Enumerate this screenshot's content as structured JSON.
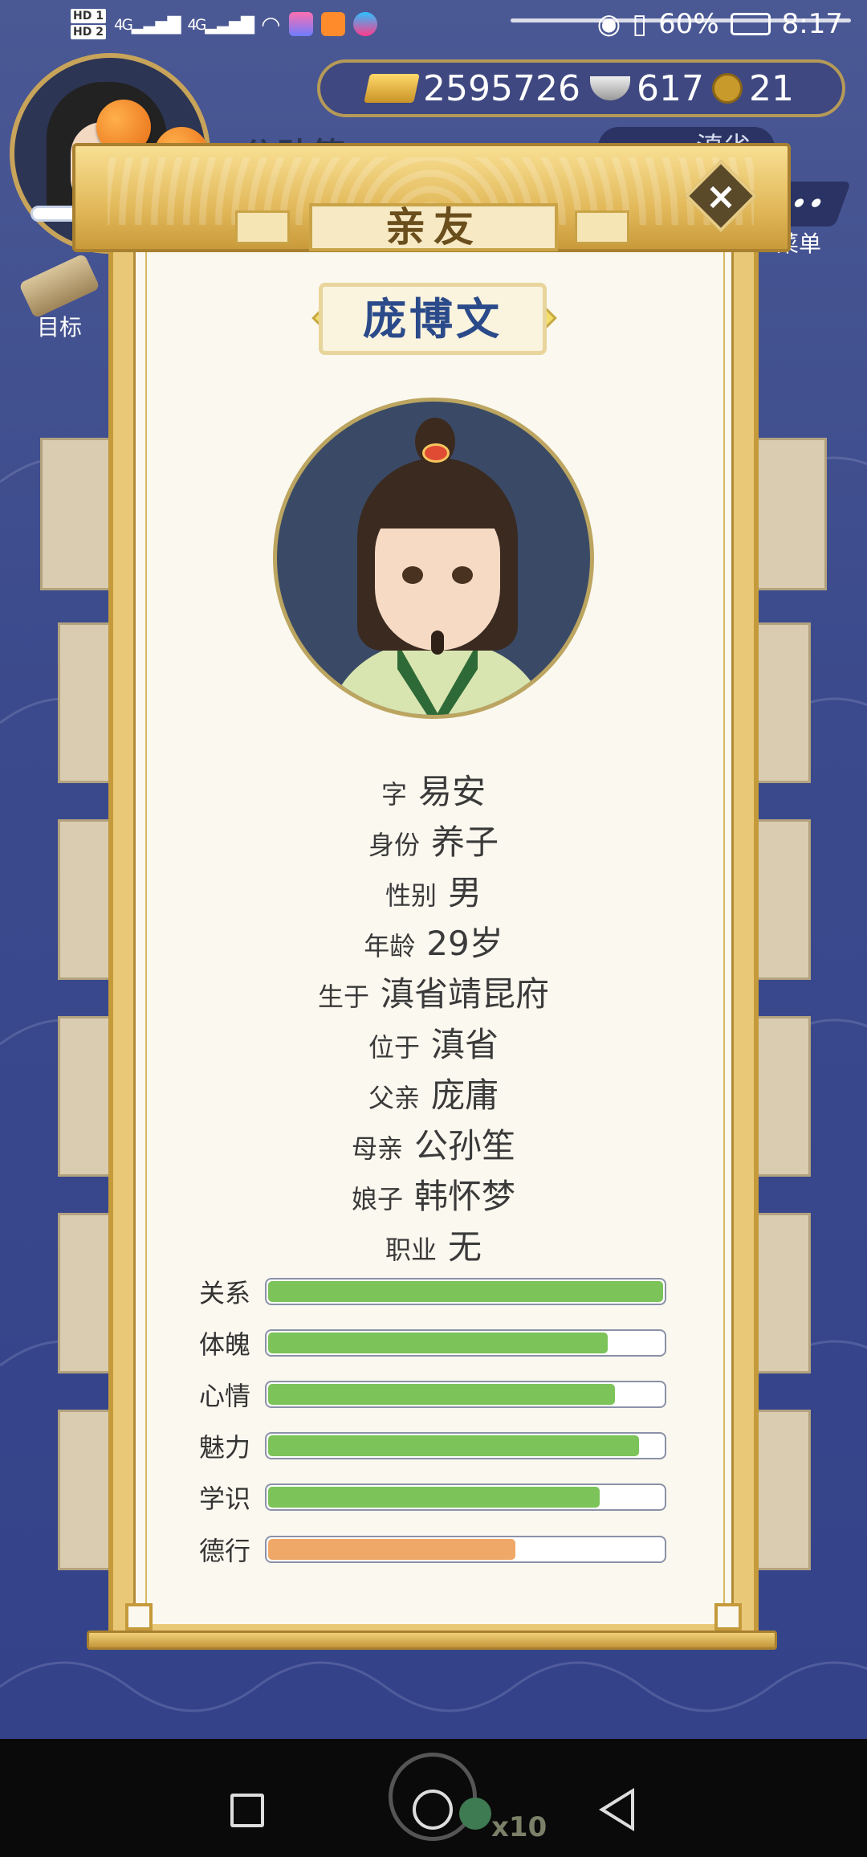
{
  "status_bar": {
    "hd1": "HD 1",
    "hd2": "HD 2",
    "net1": "4G",
    "net2": "4G",
    "battery": "60%",
    "time": "8:17"
  },
  "hud": {
    "character_name": "公孙笙",
    "currency": {
      "gold": "2595726",
      "silver": "617",
      "coin": "21"
    },
    "location_button": "滇省",
    "menu_label": "菜单",
    "goal_label": "目标"
  },
  "dialog": {
    "title": "亲友",
    "close_glyph": "×",
    "person_name": "庞博文",
    "info": [
      {
        "label": "字",
        "value": "易安"
      },
      {
        "label": "身份",
        "value": "养子"
      },
      {
        "label": "性别",
        "value": "男"
      },
      {
        "label": "年龄",
        "value": "29岁"
      },
      {
        "label": "生于",
        "value": "滇省靖昆府"
      },
      {
        "label": "位于",
        "value": "滇省"
      },
      {
        "label": "父亲",
        "value": "庞庸"
      },
      {
        "label": "母亲",
        "value": "公孙笙"
      },
      {
        "label": "娘子",
        "value": "韩怀梦"
      },
      {
        "label": "职业",
        "value": "无"
      }
    ],
    "stats": [
      {
        "label": "关系",
        "value": 1.0,
        "color": "#7cc35a"
      },
      {
        "label": "体魄",
        "value": 0.86,
        "color": "#7cc35a"
      },
      {
        "label": "心情",
        "value": 0.88,
        "color": "#7cc35a"
      },
      {
        "label": "魅力",
        "value": 0.94,
        "color": "#7cc35a"
      },
      {
        "label": "学识",
        "value": 0.84,
        "color": "#7cc35a"
      },
      {
        "label": "德行",
        "value": 0.63,
        "color": "#f0a868"
      }
    ]
  },
  "bottom": {
    "skip_multiplier": "x10"
  },
  "colors": {
    "accent_gold": "#e2b95a",
    "name_blue": "#2b4a8a",
    "bg_blue": "#3d4a8a"
  }
}
